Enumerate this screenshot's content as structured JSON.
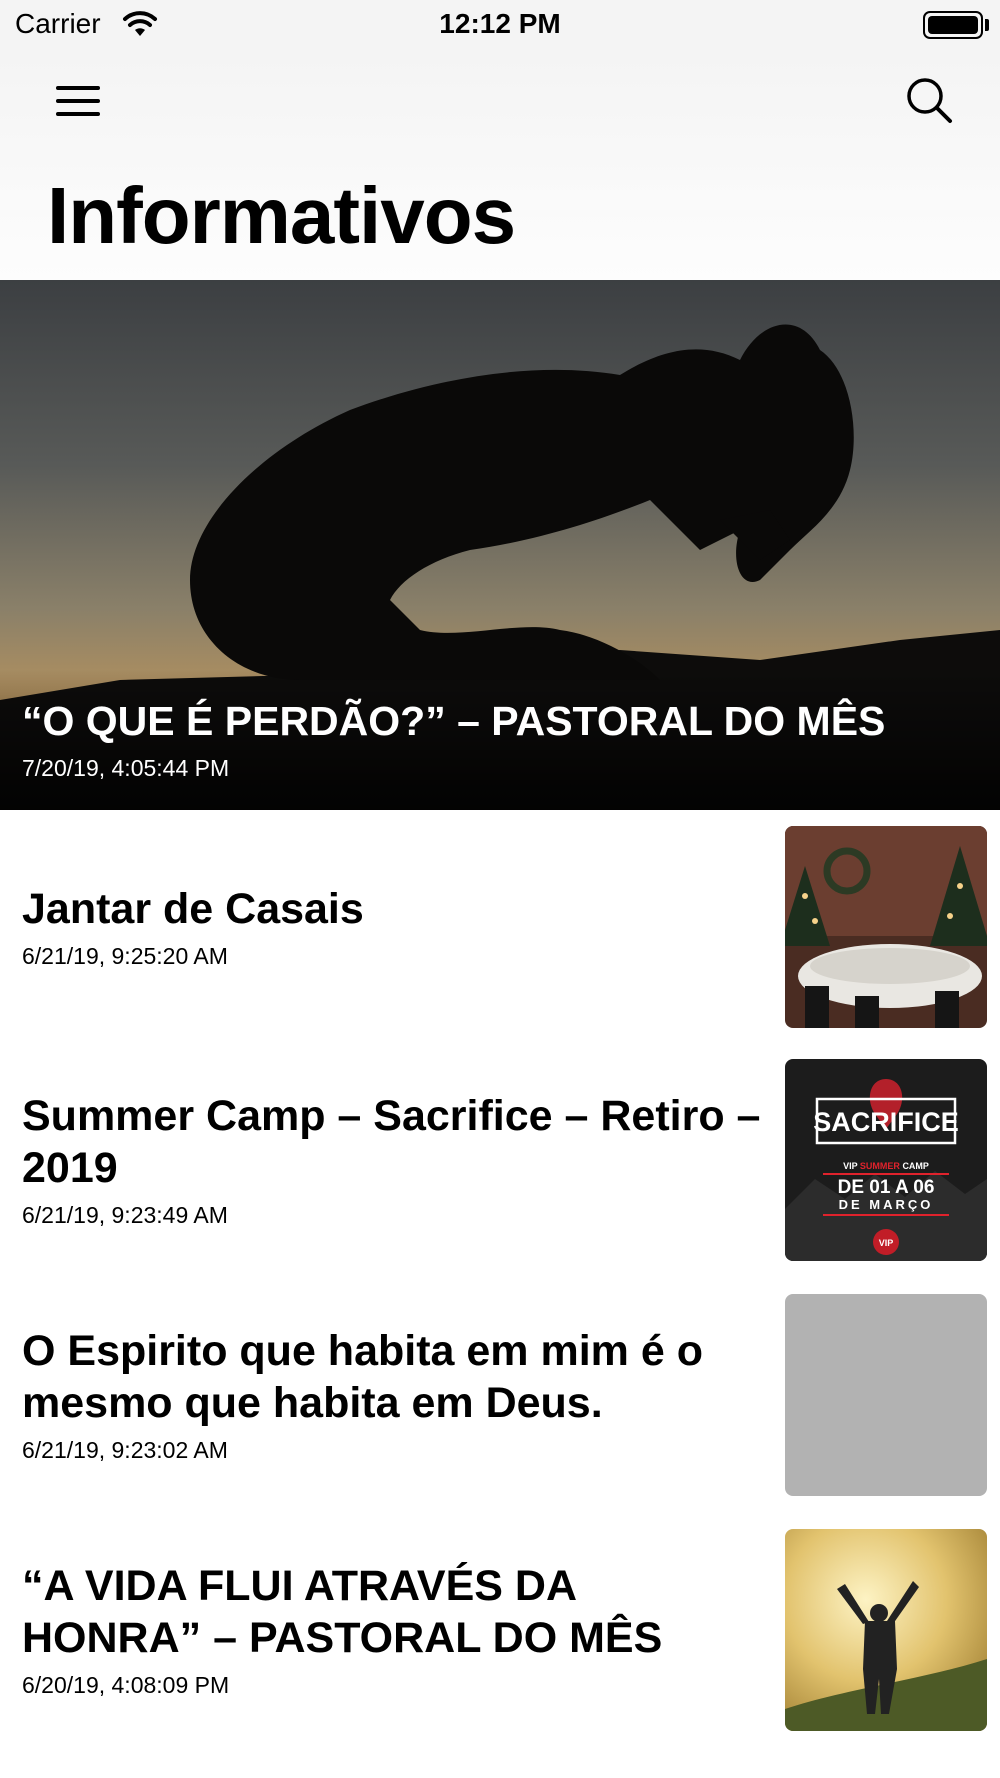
{
  "status_bar": {
    "carrier": "Carrier",
    "time": "12:12 PM"
  },
  "nav": {
    "title": "Informativos"
  },
  "hero": {
    "title": "“O QUE É PERDÃO?” – PASTORAL DO MÊS",
    "date": "7/20/19, 4:05:44 PM"
  },
  "items": [
    {
      "title": "Jantar de Casais",
      "date": "6/21/19, 9:25:20 AM"
    },
    {
      "title": "Summer Camp – Sacrifice – Retiro – 2019",
      "date": "6/21/19, 9:23:49 AM"
    },
    {
      "title": "O Espirito que habita em mim é o mesmo que habita em Deus.",
      "date": "6/21/19, 9:23:02 AM"
    },
    {
      "title": "“A VIDA FLUI ATRAVÉS DA HONRA” – PASTORAL DO MÊS",
      "date": "6/20/19, 4:08:09 PM"
    }
  ],
  "thumbnails": {
    "sacrifice_poster": {
      "heading": "SACRIFICE",
      "subtitle_vip": "VIP",
      "subtitle_summer": "SUMMER",
      "subtitle_camp": "CAMP",
      "dates_line1": "DE 01 A 06",
      "dates_line2": "DE MARÇO",
      "badge": "VIP"
    }
  }
}
